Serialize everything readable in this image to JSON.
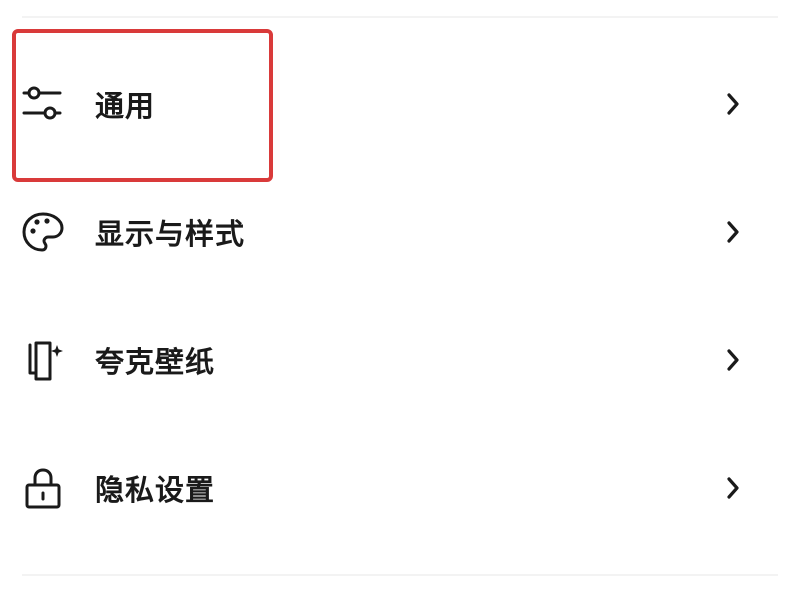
{
  "settings": {
    "items": [
      {
        "label": "通用",
        "icon": "sliders-icon",
        "highlighted": true
      },
      {
        "label": "显示与样式",
        "icon": "palette-icon",
        "highlighted": false
      },
      {
        "label": "夸克壁纸",
        "icon": "wallpaper-icon",
        "highlighted": false
      },
      {
        "label": "隐私设置",
        "icon": "lock-icon",
        "highlighted": false
      }
    ]
  },
  "colors": {
    "highlight": "#d93a3a",
    "text": "#1a1a1a",
    "background": "#ffffff"
  }
}
